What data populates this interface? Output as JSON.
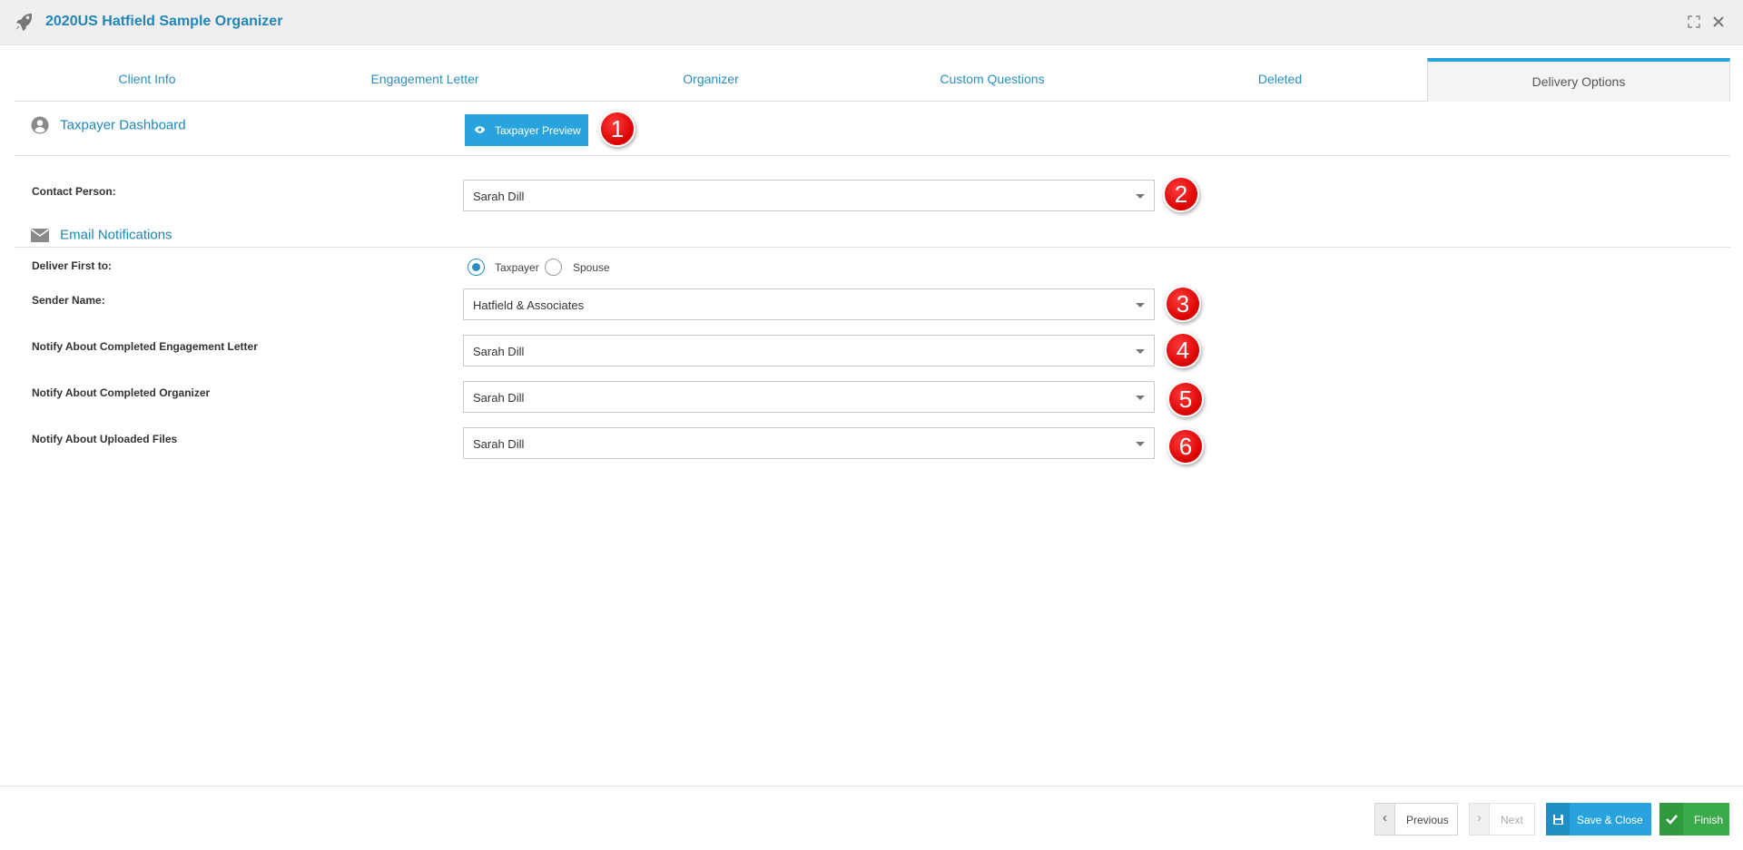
{
  "window": {
    "title": "2020US Hatfield Sample Organizer",
    "app_icon": "rocket-icon",
    "controls": [
      "expand-icon",
      "close-icon"
    ]
  },
  "tabs": [
    {
      "label": "Client Info",
      "active": false
    },
    {
      "label": "Engagement Letter",
      "active": false
    },
    {
      "label": "Organizer",
      "active": false
    },
    {
      "label": "Custom Questions",
      "active": false
    },
    {
      "label": "Deleted",
      "active": false
    },
    {
      "label": "Delivery Options",
      "active": true
    }
  ],
  "taxpayer_dashboard": {
    "heading": "Taxpayer Dashboard",
    "icon": "user-circle-icon",
    "preview_button": {
      "label": "Taxpayer Preview",
      "icon": "eye-icon"
    }
  },
  "contact_person": {
    "label": "Contact Person:",
    "value": "Sarah Dill"
  },
  "email_notifications": {
    "heading": "Email Notifications",
    "icon": "envelope-icon",
    "deliver_first_to": {
      "label": "Deliver First to:",
      "options": [
        {
          "label": "Taxpayer",
          "checked": true
        },
        {
          "label": "Spouse",
          "checked": false
        }
      ]
    },
    "sender_name": {
      "label": "Sender Name:",
      "value": "Hatfield & Associates"
    },
    "notify_engagement": {
      "label": "Notify About Completed Engagement Letter",
      "value": "Sarah Dill"
    },
    "notify_organizer": {
      "label": "Notify About Completed Organizer",
      "value": "Sarah Dill"
    },
    "notify_uploads": {
      "label": "Notify About Uploaded Files",
      "value": "Sarah Dill"
    }
  },
  "markers": [
    "1",
    "2",
    "3",
    "4",
    "5",
    "6"
  ],
  "footer": {
    "previous": "Previous",
    "next": "Next",
    "save_close": "Save & Close",
    "finish": "Finish"
  },
  "colors": {
    "accent": "#29a3dd",
    "link": "#1f86b8",
    "finish": "#3aab4a",
    "marker": "#e00000"
  }
}
